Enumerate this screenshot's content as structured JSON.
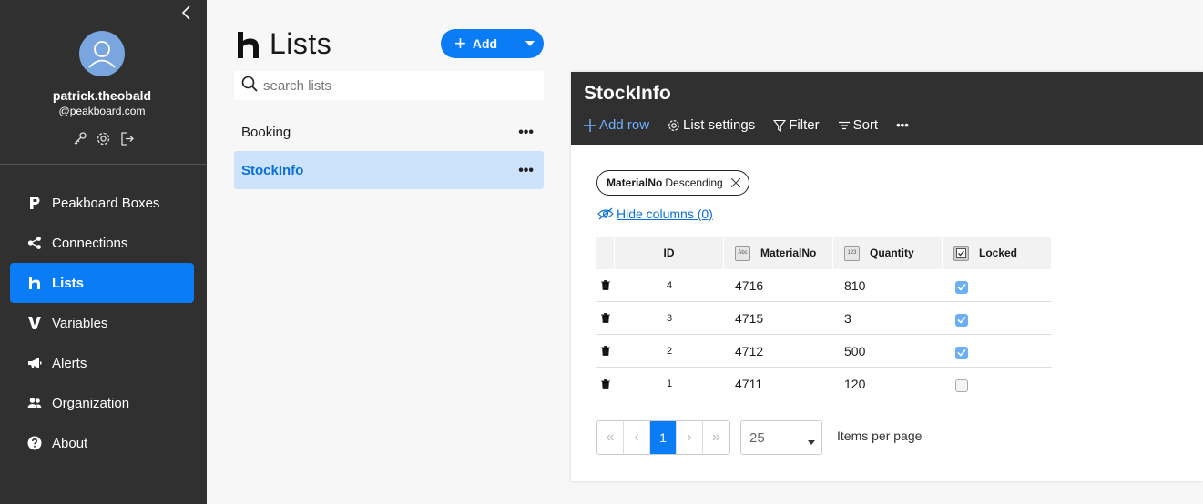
{
  "sidebar": {
    "user": {
      "name": "patrick.theobald",
      "domain": "@peakboard.com"
    },
    "items": [
      {
        "label": "Peakboard Boxes",
        "icon": "peakboard-p-icon"
      },
      {
        "label": "Connections",
        "icon": "share-nodes-icon"
      },
      {
        "label": "Lists",
        "icon": "lists-h-icon",
        "active": true
      },
      {
        "label": "Variables",
        "icon": "variables-v-icon"
      },
      {
        "label": "Alerts",
        "icon": "megaphone-icon"
      },
      {
        "label": "Organization",
        "icon": "users-icon"
      },
      {
        "label": "About",
        "icon": "question-circle-icon"
      }
    ]
  },
  "lists": {
    "title": "Lists",
    "add_label": "Add",
    "search_placeholder": "search lists",
    "items": [
      {
        "label": "Booking",
        "selected": false
      },
      {
        "label": "StockInfo",
        "selected": true
      }
    ]
  },
  "panel": {
    "title": "StockInfo",
    "toolbar": {
      "add_row": "Add row",
      "list_settings": "List settings",
      "filter": "Filter",
      "sort": "Sort"
    },
    "sort_chip": {
      "field": "MaterialNo",
      "direction": "Descending"
    },
    "hide_columns": "Hide columns (0)",
    "columns": [
      {
        "label": "ID"
      },
      {
        "label": "MaterialNo",
        "type_icon": "Abc"
      },
      {
        "label": "Quantity",
        "type_icon": "123"
      },
      {
        "label": "Locked",
        "type_icon": "checkbox"
      }
    ],
    "rows": [
      {
        "id": "4",
        "material": "4716",
        "quantity": "810",
        "locked": true
      },
      {
        "id": "3",
        "material": "4715",
        "quantity": "3",
        "locked": true
      },
      {
        "id": "2",
        "material": "4712",
        "quantity": "500",
        "locked": true
      },
      {
        "id": "1",
        "material": "4711",
        "quantity": "120",
        "locked": false
      }
    ],
    "pagination": {
      "first": "«",
      "prev": "‹",
      "current": "1",
      "next": "›",
      "last": "»",
      "per_page_value": "25",
      "per_page_label": "Items per page"
    }
  },
  "colors": {
    "accent": "#0a7cf5",
    "sidebar_bg": "#303030",
    "selected_bg": "#cde3fb",
    "checkbox_on": "#6cb0f3"
  }
}
